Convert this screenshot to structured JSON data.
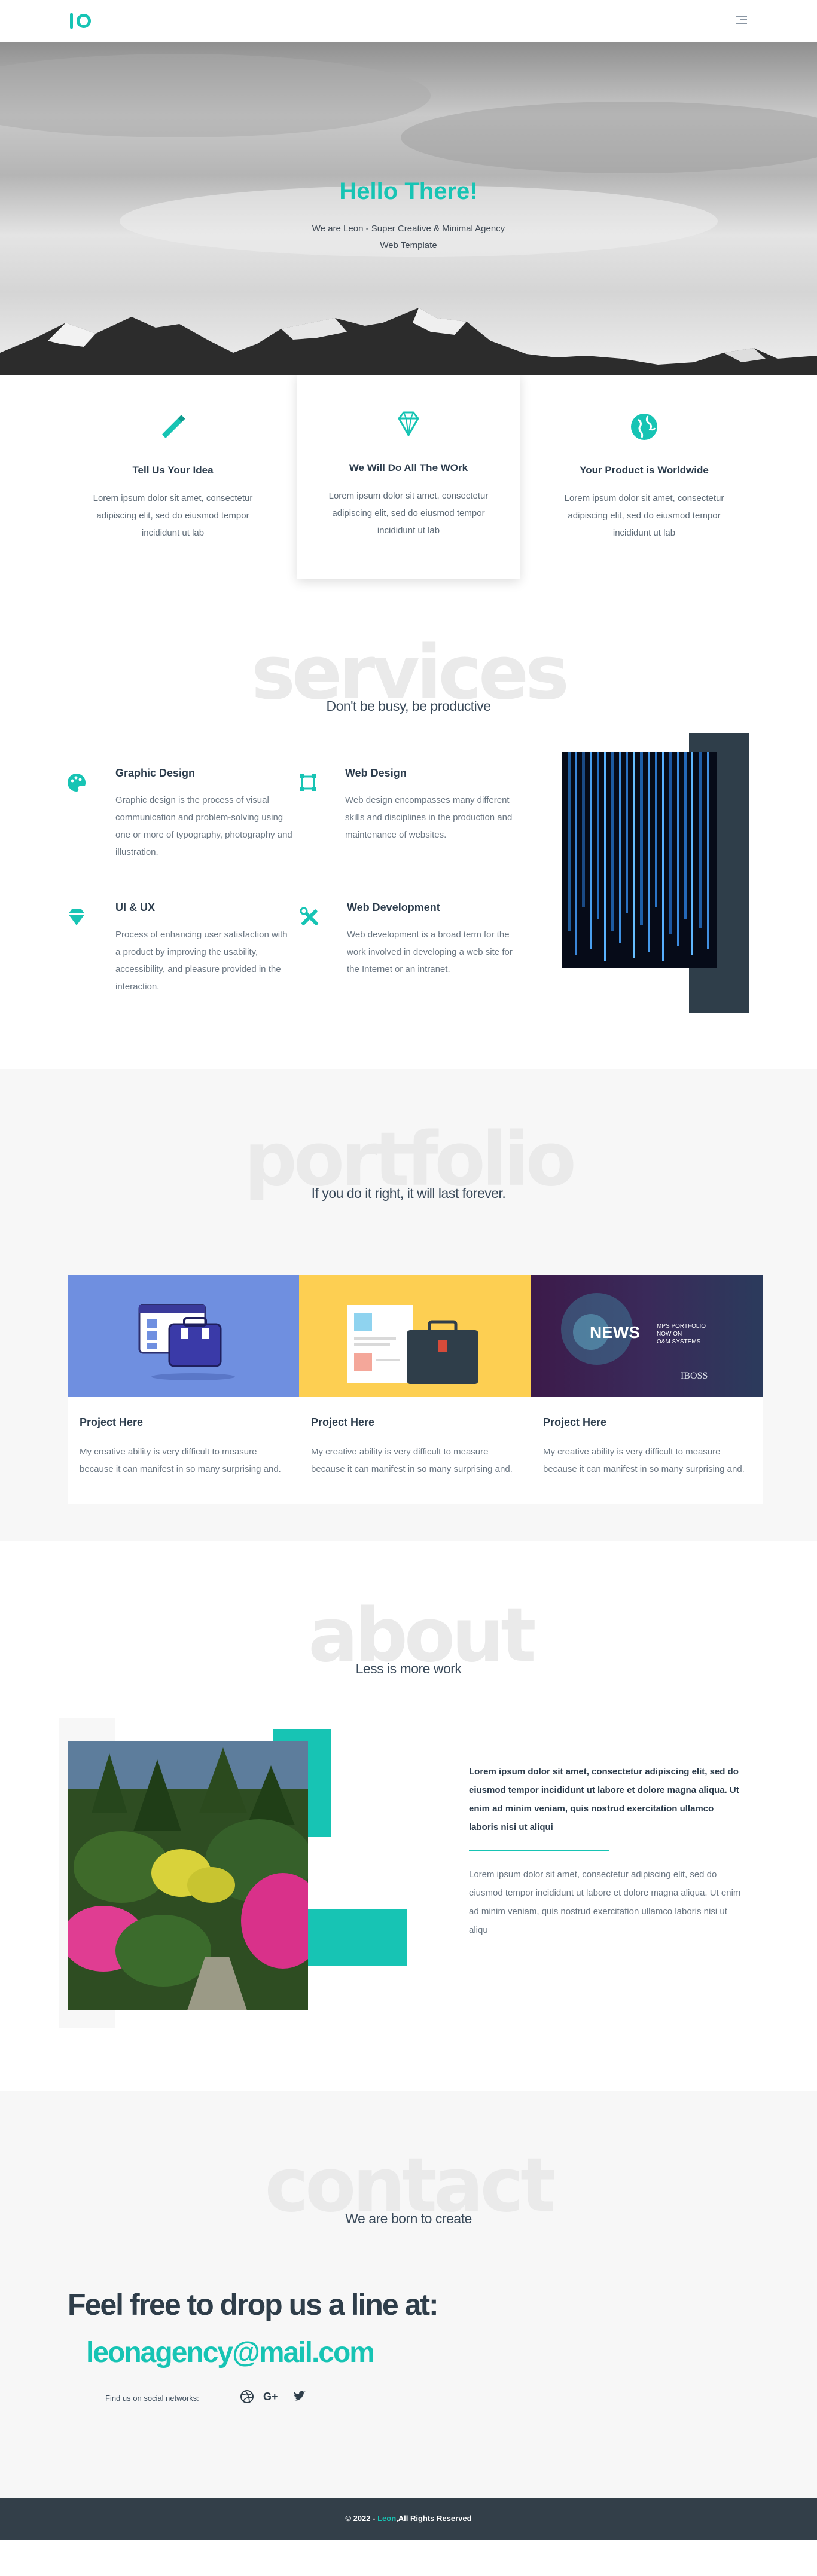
{
  "nav": {
    "logo_icon": "leon-logo-icon",
    "menu_icon": "hamburger-icon"
  },
  "hero": {
    "title": "Hello There!",
    "subtitle": "We are Leon - Super Creative & Minimal Agency Web Template"
  },
  "features": [
    {
      "icon": "pencil-icon",
      "title": "Tell Us Your Idea",
      "text": "Lorem ipsum dolor sit amet, consectetur adipiscing elit, sed do eiusmod tempor incididunt ut lab"
    },
    {
      "icon": "diamond-icon",
      "title": "We Will Do All The WOrk",
      "text": "Lorem ipsum dolor sit amet, consectetur adipiscing elit, sed do eiusmod tempor incididunt ut lab"
    },
    {
      "icon": "globe-icon",
      "title": "Your Product is Worldwide",
      "text": "Lorem ipsum dolor sit amet, consectetur adipiscing elit, sed do eiusmod tempor incididunt ut lab"
    }
  ],
  "services": {
    "big": "services",
    "subtitle": "Don't be busy, be productive",
    "items": [
      {
        "icon": "palette-icon",
        "title": "Graphic Design",
        "text": "Graphic design is the process of visual communication and problem-solving using one or more of typography, photography and illustration."
      },
      {
        "icon": "crop-icon",
        "title": "Web Design",
        "text": "Web design encompasses many different skills and disciplines in the production and maintenance of websites."
      },
      {
        "icon": "gem-icon",
        "title": "UI & UX",
        "text": "Process of enhancing user satisfaction with a product by improving the usability, accessibility, and pleasure provided in the interaction."
      },
      {
        "icon": "tools-icon",
        "title": "Web Development",
        "text": "Web development is a broad term for the work involved in developing a web site for the Internet or an intranet."
      }
    ]
  },
  "portfolio": {
    "big": "portfolio",
    "subtitle": "If you do it right, it will last forever.",
    "items": [
      {
        "title": "Project Here",
        "text": "My creative ability is very difficult to measure because it can manifest in so many surprising and."
      },
      {
        "title": "Project Here",
        "text": "My creative ability is very difficult to measure because it can manifest in so many surprising and."
      },
      {
        "title": "Project Here",
        "text": "My creative ability is very difficult to measure because it can manifest in so many surprising and.",
        "thumb_title": "NEWS",
        "thumb_sub1": "MPS PORTFOLIO",
        "thumb_sub2": "NOW ON",
        "thumb_sub3": "O&M SYSTEMS",
        "thumb_brand": "IBOSS"
      }
    ]
  },
  "about": {
    "big": "about",
    "subtitle": "Less is more work",
    "bold_text": "Lorem ipsum dolor sit amet, consectetur adipiscing elit, sed do eiusmod tempor incididunt ut labore et dolore magna aliqua. Ut enim ad minim veniam, quis nostrud exercitation ullamco laboris nisi ut aliqui",
    "text": "Lorem ipsum dolor sit amet, consectetur adipiscing elit, sed do eiusmod tempor incididunt ut labore et dolore magna aliqua. Ut enim ad minim veniam, quis nostrud exercitation ullamco laboris nisi ut aliqu"
  },
  "contact": {
    "big": "contact",
    "subtitle": "We are born to create",
    "heading": "Feel free to drop us a line at:",
    "email": "leonagency@mail.com",
    "social_label": "Find us on social networks:",
    "social": [
      "dribbble-icon",
      "google-plus-icon",
      "twitter-icon"
    ]
  },
  "footer": {
    "prefix": "© 2022 - ",
    "brand": "Leon",
    "suffix": ",All Rights Reserved"
  },
  "colors": {
    "accent": "#17c4b4",
    "dark": "#2d3d4d",
    "footer": "#333f49"
  }
}
